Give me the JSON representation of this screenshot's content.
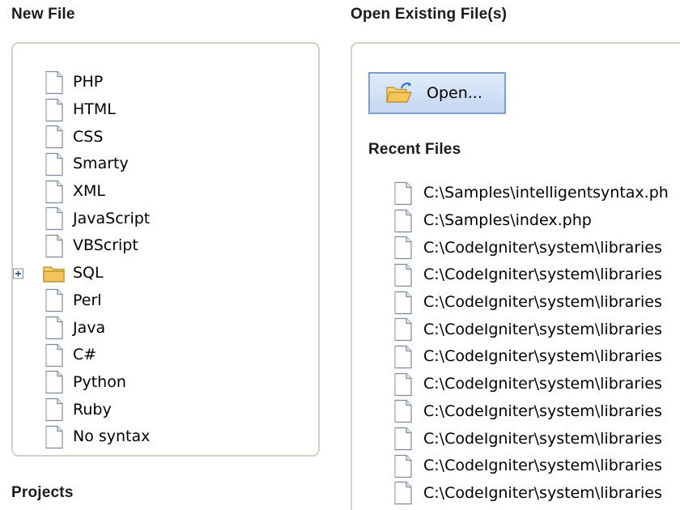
{
  "new_file": {
    "heading": "New File",
    "items": [
      {
        "label": "PHP",
        "icon": "document-icon"
      },
      {
        "label": "HTML",
        "icon": "document-icon"
      },
      {
        "label": "CSS",
        "icon": "document-icon"
      },
      {
        "label": "Smarty",
        "icon": "document-icon"
      },
      {
        "label": "XML",
        "icon": "document-icon"
      },
      {
        "label": "JavaScript",
        "icon": "document-icon"
      },
      {
        "label": "VBScript",
        "icon": "document-icon"
      },
      {
        "label": "SQL",
        "icon": "folder-icon",
        "expandable": true
      },
      {
        "label": "Perl",
        "icon": "document-icon"
      },
      {
        "label": "Java",
        "icon": "document-icon"
      },
      {
        "label": "C#",
        "icon": "document-icon"
      },
      {
        "label": "Python",
        "icon": "document-icon"
      },
      {
        "label": "Ruby",
        "icon": "document-icon"
      },
      {
        "label": "No syntax",
        "icon": "document-icon"
      }
    ]
  },
  "open_existing": {
    "heading": "Open Existing File(s)",
    "open_button_label": "Open...",
    "recent_heading": "Recent Files",
    "recent_files": [
      "C:\\Samples\\intelligentsyntax.ph",
      "C:\\Samples\\index.php",
      "C:\\CodeIgniter\\system\\libraries",
      "C:\\CodeIgniter\\system\\libraries",
      "C:\\CodeIgniter\\system\\libraries",
      "C:\\CodeIgniter\\system\\libraries",
      "C:\\CodeIgniter\\system\\libraries",
      "C:\\CodeIgniter\\system\\libraries",
      "C:\\CodeIgniter\\system\\libraries",
      "C:\\CodeIgniter\\system\\libraries",
      "C:\\CodeIgniter\\system\\libraries",
      "C:\\CodeIgniter\\system\\libraries"
    ]
  },
  "projects": {
    "heading": "Projects"
  },
  "colors": {
    "panel_border": "#d2d0c7",
    "button_border": "#7d9fcf",
    "button_fill": "#c3d7f2",
    "folder_fill": "#f3c65a"
  }
}
